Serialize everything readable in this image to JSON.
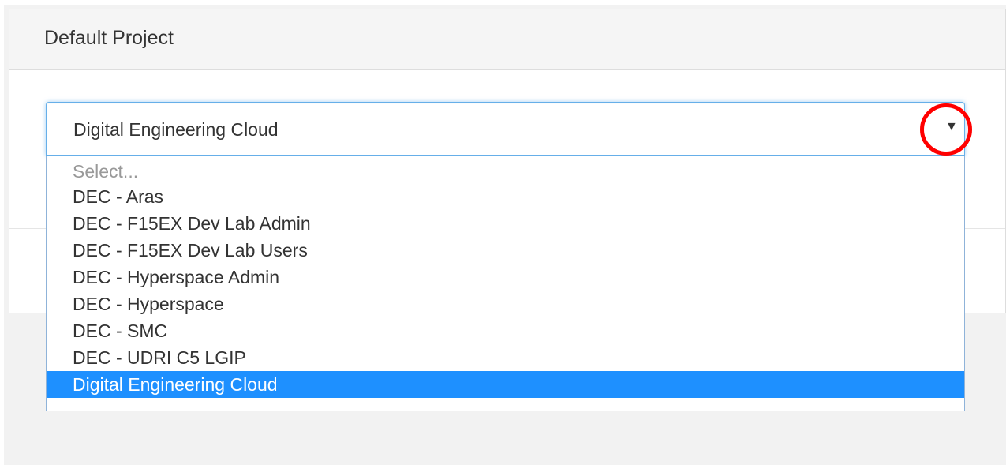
{
  "panel": {
    "title": "Default Project"
  },
  "select": {
    "current_value": "Digital Engineering Cloud",
    "arrow_icon": "triangle-down-icon",
    "placeholder": "Select...",
    "options": [
      "DEC - Aras",
      "DEC - F15EX Dev Lab Admin",
      "DEC - F15EX Dev Lab Users",
      "DEC - Hyperspace Admin",
      "DEC - Hyperspace",
      "DEC - SMC",
      "DEC - UDRI C5 LGIP",
      "Digital Engineering Cloud"
    ],
    "selected_option": "Digital Engineering Cloud"
  },
  "colors": {
    "selected_bg": "#1e90ff",
    "focus_border": "#66afe9",
    "annotation": "#ff0000"
  }
}
